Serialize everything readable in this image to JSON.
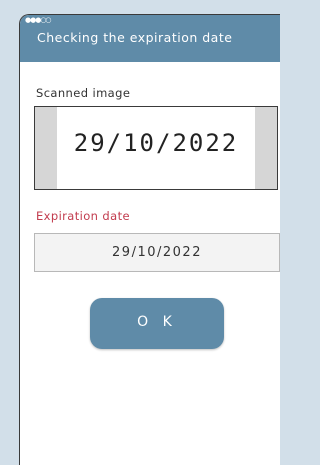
{
  "status_bar": {
    "signal_dots": "●●●○○"
  },
  "header": {
    "title": "Checking the expiration date"
  },
  "scanned": {
    "label": "Scanned image",
    "date_text": "29/10/2022"
  },
  "expiration": {
    "label": "Expiration date",
    "value": "29/10/2022"
  },
  "ok_button": {
    "label": "O K"
  },
  "colors": {
    "accent": "#5f8ba8",
    "label_red": "#c23c4e",
    "page_bg": "#d2dfe9"
  }
}
